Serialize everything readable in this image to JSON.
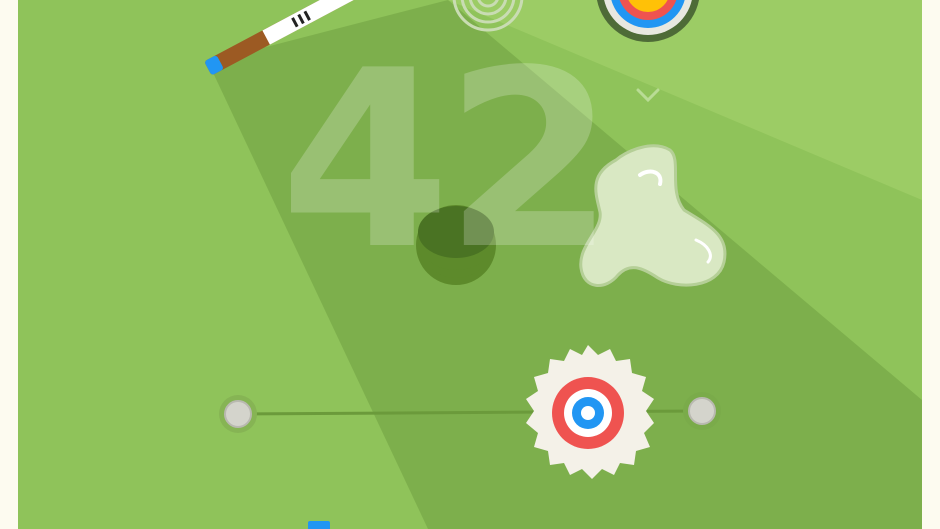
{
  "game": {
    "score": "42"
  },
  "colors": {
    "background_frame": "#fdfbf0",
    "grass": "#8fc35a",
    "grass_light": "#9ccc65",
    "aim_beam": "#7aab4a",
    "hole": "#5d8a2b",
    "hole_rim": "#4a7323",
    "cue_wood": "#9c5a23",
    "cue_tip": "#2196f3",
    "cue_stripe": "#ffffff",
    "saw_blade": "#f4f1e8",
    "saw_ring_red": "#ef5350",
    "saw_ring_blue": "#2196f3",
    "slime": "#d9e8c3",
    "rail_node": "#d4d4cc"
  },
  "icons": {
    "cue": "pool-cue-icon",
    "target_spiral": "spiral-target-icon",
    "bullseye": "bullseye-target-icon",
    "chevron": "chevron-down-icon",
    "saw": "saw-blade-icon",
    "slime": "slime-blob-icon",
    "hole": "golf-hole-icon",
    "rail_node": "rail-anchor-icon"
  }
}
